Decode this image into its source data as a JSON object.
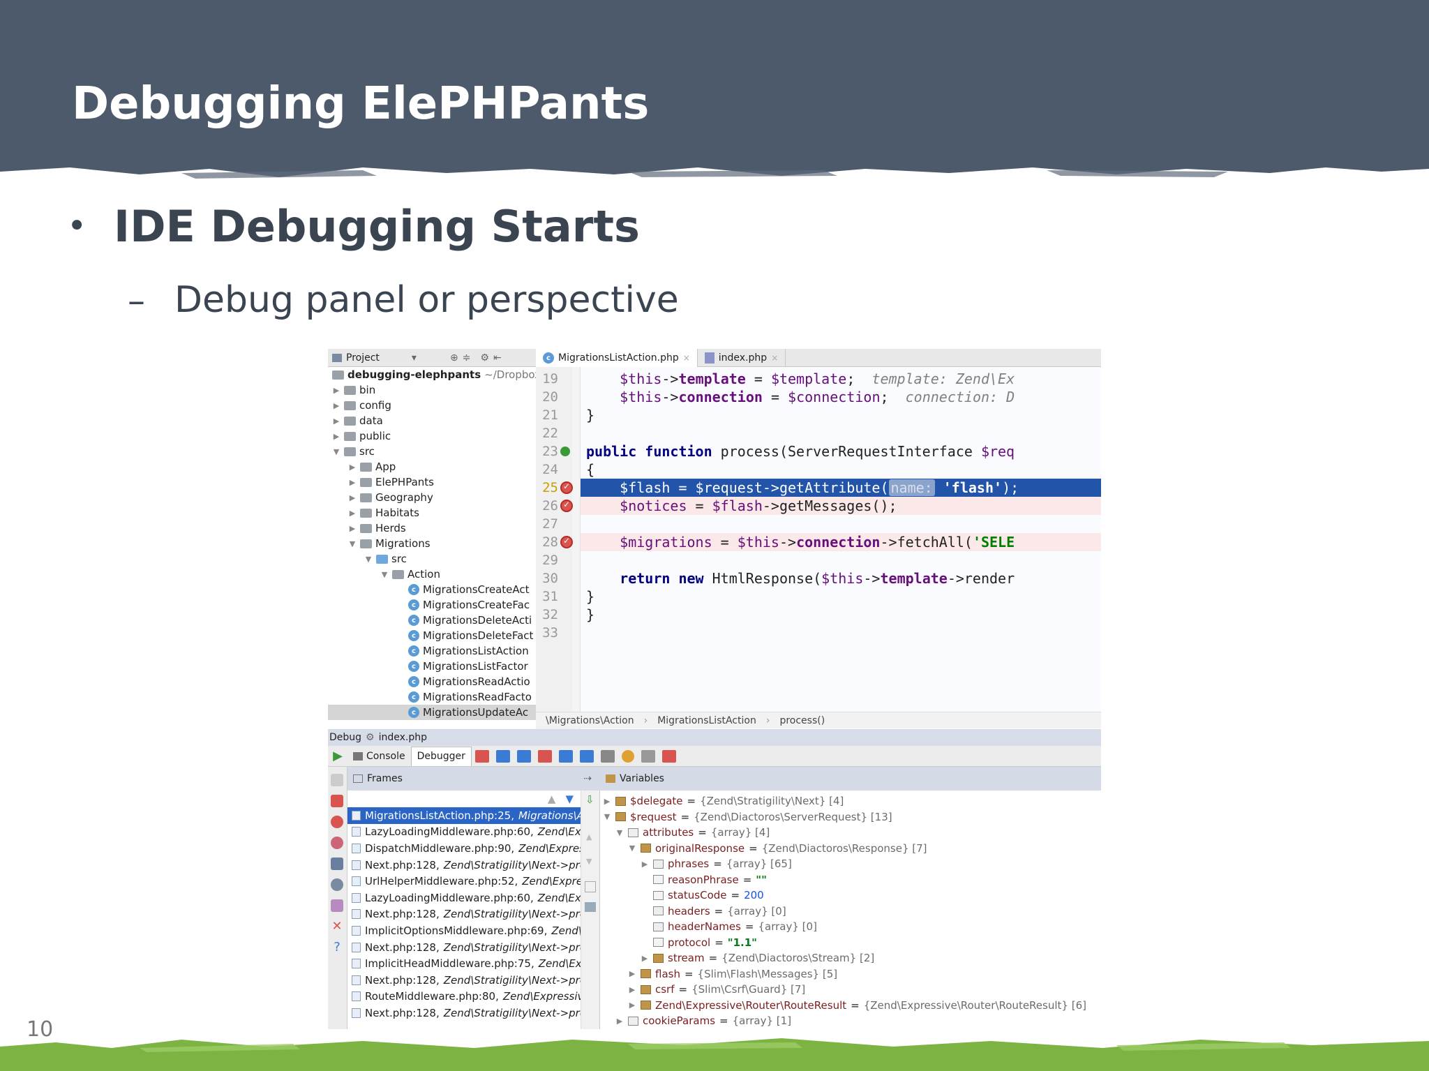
{
  "slide": {
    "title": "Debugging ElePHPants",
    "bullet": "IDE Debugging Starts",
    "sub_bullet": "Debug panel or perspective",
    "page_number": "10"
  },
  "ide": {
    "project_panel": {
      "label": "Project",
      "root_name": "debugging-elephpants",
      "root_path": "~/Dropbox/",
      "tree": [
        {
          "label": "bin",
          "depth": 0,
          "type": "folder",
          "expanded": false
        },
        {
          "label": "config",
          "depth": 0,
          "type": "folder",
          "expanded": false
        },
        {
          "label": "data",
          "depth": 0,
          "type": "folder",
          "expanded": false
        },
        {
          "label": "public",
          "depth": 0,
          "type": "folder",
          "expanded": false
        },
        {
          "label": "src",
          "depth": 0,
          "type": "folder",
          "expanded": true
        },
        {
          "label": "App",
          "depth": 1,
          "type": "folder",
          "expanded": false
        },
        {
          "label": "ElePHPants",
          "depth": 1,
          "type": "folder",
          "expanded": false
        },
        {
          "label": "Geography",
          "depth": 1,
          "type": "folder",
          "expanded": false
        },
        {
          "label": "Habitats",
          "depth": 1,
          "type": "folder",
          "expanded": false
        },
        {
          "label": "Herds",
          "depth": 1,
          "type": "folder",
          "expanded": false
        },
        {
          "label": "Migrations",
          "depth": 1,
          "type": "folder",
          "expanded": true
        },
        {
          "label": "src",
          "depth": 2,
          "type": "folder-blue",
          "expanded": true
        },
        {
          "label": "Action",
          "depth": 3,
          "type": "folder",
          "expanded": true
        },
        {
          "label": "MigrationsCreateAct",
          "depth": 4,
          "type": "class"
        },
        {
          "label": "MigrationsCreateFac",
          "depth": 4,
          "type": "class"
        },
        {
          "label": "MigrationsDeleteActi",
          "depth": 4,
          "type": "class"
        },
        {
          "label": "MigrationsDeleteFact",
          "depth": 4,
          "type": "class"
        },
        {
          "label": "MigrationsListAction",
          "depth": 4,
          "type": "class"
        },
        {
          "label": "MigrationsListFactor",
          "depth": 4,
          "type": "class"
        },
        {
          "label": "MigrationsReadActio",
          "depth": 4,
          "type": "class"
        },
        {
          "label": "MigrationsReadFacto",
          "depth": 4,
          "type": "class"
        },
        {
          "label": "MigrationsUpdateAc",
          "depth": 4,
          "type": "class",
          "selected": true
        }
      ]
    },
    "editor_tabs": [
      {
        "label": "MigrationsListAction.php",
        "active": true
      },
      {
        "label": "index.php",
        "active": false
      }
    ],
    "code_lines": [
      {
        "num": "19",
        "html": "    <span class=\"var\">$this</span>-><span class=\"field\">template</span> = <span class=\"var\">$template</span>;  <span class=\"hint\">template: Zend\\Ex</span>"
      },
      {
        "num": "20",
        "html": "    <span class=\"var\">$this</span>-><span class=\"field\">connection</span> = <span class=\"var\">$connection</span>;  <span class=\"hint\">connection: D</span>"
      },
      {
        "num": "21",
        "html": "}"
      },
      {
        "num": "22",
        "html": ""
      },
      {
        "num": "23",
        "html": "<span class=\"kw\">public function</span> process(ServerRequestInterface <span class=\"var\">$req</span>"
      },
      {
        "num": "24",
        "html": "{"
      },
      {
        "num": "25",
        "html": "    <span class=\"var\">$flash</span> = <span class=\"var\">$request</span>->getAttribute(<span class=\"param-hint\">name:</span> <span class=\"str\">'flash'</span>);",
        "state": "current"
      },
      {
        "num": "26",
        "html": "    <span class=\"var\">$notices</span> = <span class=\"var\">$flash</span>->getMessages();",
        "state": "bp"
      },
      {
        "num": "27",
        "html": ""
      },
      {
        "num": "28",
        "html": "    <span class=\"var\">$migrations</span> = <span class=\"var\">$this</span>-><span class=\"field\">connection</span>->fetchAll(<span class=\"str\">'SELE</span>",
        "state": "bp"
      },
      {
        "num": "29",
        "html": ""
      },
      {
        "num": "30",
        "html": "    <span class=\"kw\">return new</span> HtmlResponse(<span class=\"var\">$this</span>-><span class=\"field\">template</span>->render"
      },
      {
        "num": "31",
        "html": "}"
      },
      {
        "num": "32",
        "html": "}"
      },
      {
        "num": "33",
        "html": ""
      }
    ],
    "breadcrumbs": [
      "\\Migrations\\Action",
      "MigrationsListAction",
      "process()"
    ],
    "debug": {
      "label": "Debug",
      "config": "index.php",
      "tabs": [
        "Console",
        "Debugger"
      ],
      "frames_label": "Frames",
      "variables_label": "Variables",
      "frames": [
        {
          "file": "MigrationsListAction.php:25,",
          "ctx": "Migrations\\A",
          "selected": true
        },
        {
          "file": "LazyLoadingMiddleware.php:60,",
          "ctx": "Zend\\Exp"
        },
        {
          "file": "DispatchMiddleware.php:90,",
          "ctx": "Zend\\Express"
        },
        {
          "file": "Next.php:128,",
          "ctx": "Zend\\Stratigility\\Next->proc"
        },
        {
          "file": "UrlHelperMiddleware.php:52,",
          "ctx": "Zend\\Expres"
        },
        {
          "file": "LazyLoadingMiddleware.php:60,",
          "ctx": "Zend\\Exp"
        },
        {
          "file": "Next.php:128,",
          "ctx": "Zend\\Stratigility\\Next->proc"
        },
        {
          "file": "ImplicitOptionsMiddleware.php:69,",
          "ctx": "Zend\\E"
        },
        {
          "file": "Next.php:128,",
          "ctx": "Zend\\Stratigility\\Next->proc"
        },
        {
          "file": "ImplicitHeadMiddleware.php:75,",
          "ctx": "Zend\\Exp"
        },
        {
          "file": "Next.php:128,",
          "ctx": "Zend\\Stratigility\\Next->proc"
        },
        {
          "file": "RouteMiddleware.php:80,",
          "ctx": "Zend\\Expressive"
        },
        {
          "file": "Next.php:128,",
          "ctx": "Zend\\Stratigility\\Next->proc"
        }
      ],
      "variables": [
        {
          "depth": 0,
          "arrow": "▶",
          "icon": "obj",
          "name": "$delegate",
          "type": "{Zend\\Stratigility\\Next} [4]"
        },
        {
          "depth": 0,
          "arrow": "▼",
          "icon": "obj",
          "name": "$request",
          "type": "{Zend\\Diactoros\\ServerRequest} [13]"
        },
        {
          "depth": 1,
          "arrow": "▼",
          "icon": "arr",
          "name": "attributes",
          "type": "{array} [4]"
        },
        {
          "depth": 2,
          "arrow": "▼",
          "icon": "obj",
          "name": "originalResponse",
          "type": "{Zend\\Diactoros\\Response} [7]"
        },
        {
          "depth": 3,
          "arrow": "▶",
          "icon": "arr",
          "name": "phrases",
          "type": "{array} [65]"
        },
        {
          "depth": 3,
          "arrow": "",
          "icon": "prim",
          "name": "reasonPhrase",
          "value": "\"\"",
          "vclass": "str-val"
        },
        {
          "depth": 3,
          "arrow": "",
          "icon": "prim",
          "name": "statusCode",
          "value": "200",
          "vclass": "num-val"
        },
        {
          "depth": 3,
          "arrow": "",
          "icon": "arr",
          "name": "headers",
          "type": "{array} [0]"
        },
        {
          "depth": 3,
          "arrow": "",
          "icon": "arr",
          "name": "headerNames",
          "type": "{array} [0]"
        },
        {
          "depth": 3,
          "arrow": "",
          "icon": "prim",
          "name": "protocol",
          "value": "\"1.1\"",
          "vclass": "str-val"
        },
        {
          "depth": 3,
          "arrow": "▶",
          "icon": "obj",
          "name": "stream",
          "type": "{Zend\\Diactoros\\Stream} [2]"
        },
        {
          "depth": 2,
          "arrow": "▶",
          "icon": "obj",
          "name": "flash",
          "type": "{Slim\\Flash\\Messages} [5]"
        },
        {
          "depth": 2,
          "arrow": "▶",
          "icon": "obj",
          "name": "csrf",
          "type": "{Slim\\Csrf\\Guard} [7]"
        },
        {
          "depth": 2,
          "arrow": "▶",
          "icon": "obj",
          "name": "Zend\\Expressive\\Router\\RouteResult",
          "type": "{Zend\\Expressive\\Router\\RouteResult} [6]"
        },
        {
          "depth": 1,
          "arrow": "▶",
          "icon": "arr",
          "name": "cookieParams",
          "type": "{array} [1]"
        }
      ]
    }
  }
}
